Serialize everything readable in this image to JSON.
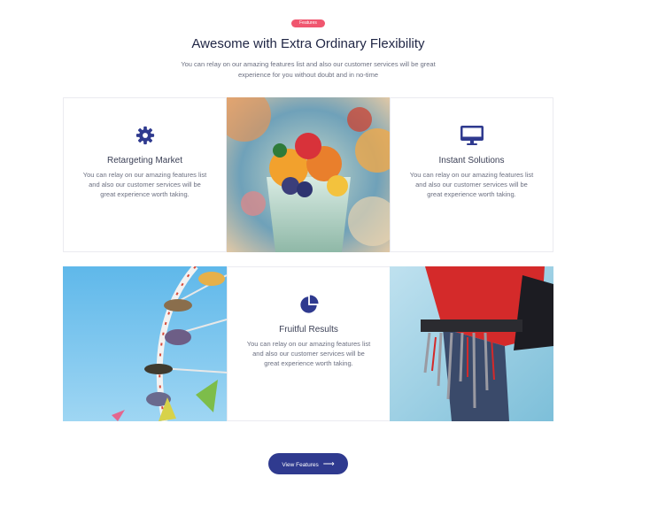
{
  "header": {
    "badge": "Features",
    "title": "Awesome with Extra Ordinary Flexibility",
    "subtitle": "You can relay on our amazing features list and also our customer services will be great experience for you without doubt and in no-time"
  },
  "features": [
    {
      "icon": "gear-icon",
      "title": "Retargeting Market",
      "description": "You can relay on our amazing features list and also our customer services will be great experience worth taking."
    },
    {
      "icon": "desktop-icon",
      "title": "Instant Solutions",
      "description": "You can relay on our amazing features list and also our customer services will be great experience worth taking."
    },
    {
      "icon": "pie-chart-icon",
      "title": "Fruitful Results",
      "description": "You can relay on our amazing features list and also our customer services will be great experience worth taking."
    }
  ],
  "photos": [
    {
      "name": "fruit-bowl-photo"
    },
    {
      "name": "ferris-wheel-photo"
    },
    {
      "name": "climbing-gear-photo"
    }
  ],
  "cta": {
    "label": "View Features",
    "icon": "arrow-right-icon"
  },
  "colors": {
    "accent": "#2f3a8f",
    "badge": "#f0566f",
    "heading": "#1f2544"
  }
}
